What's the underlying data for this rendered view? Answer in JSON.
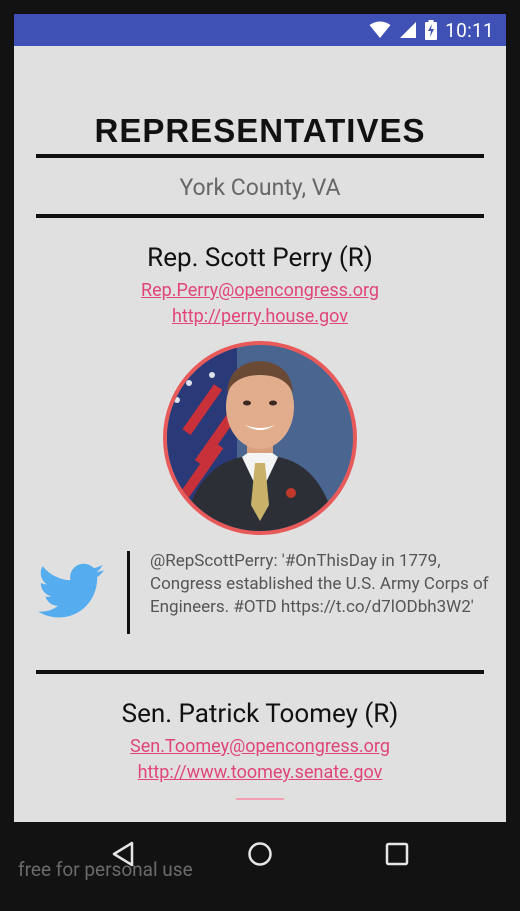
{
  "status_bar": {
    "time": "10:11"
  },
  "header": {
    "title": "REPRESENTATIVES",
    "location": "York County, VA"
  },
  "representatives": [
    {
      "name": "Rep. Scott Perry (R)",
      "email": "Rep.Perry@opencongress.org",
      "website": "http://perry.house.gov",
      "tweet": "@RepScottPerry: '#OnThisDay in 1779, Congress established the U.S. Army Corps of Engineers. #OTD https://t.co/d7lODbh3W2'"
    },
    {
      "name": "Sen. Patrick Toomey (R)",
      "email": "Sen.Toomey@opencongress.org",
      "website": "http://www.toomey.senate.gov"
    }
  ],
  "watermark": "free for personal use",
  "colors": {
    "status_bar": "#3f51b5",
    "link": "#e0457b",
    "photo_border": "#e85a5a",
    "twitter": "#55acee"
  },
  "icons": [
    "wifi-icon",
    "signal-icon",
    "battery-icon",
    "twitter-icon",
    "back-icon",
    "home-icon",
    "recents-icon"
  ]
}
